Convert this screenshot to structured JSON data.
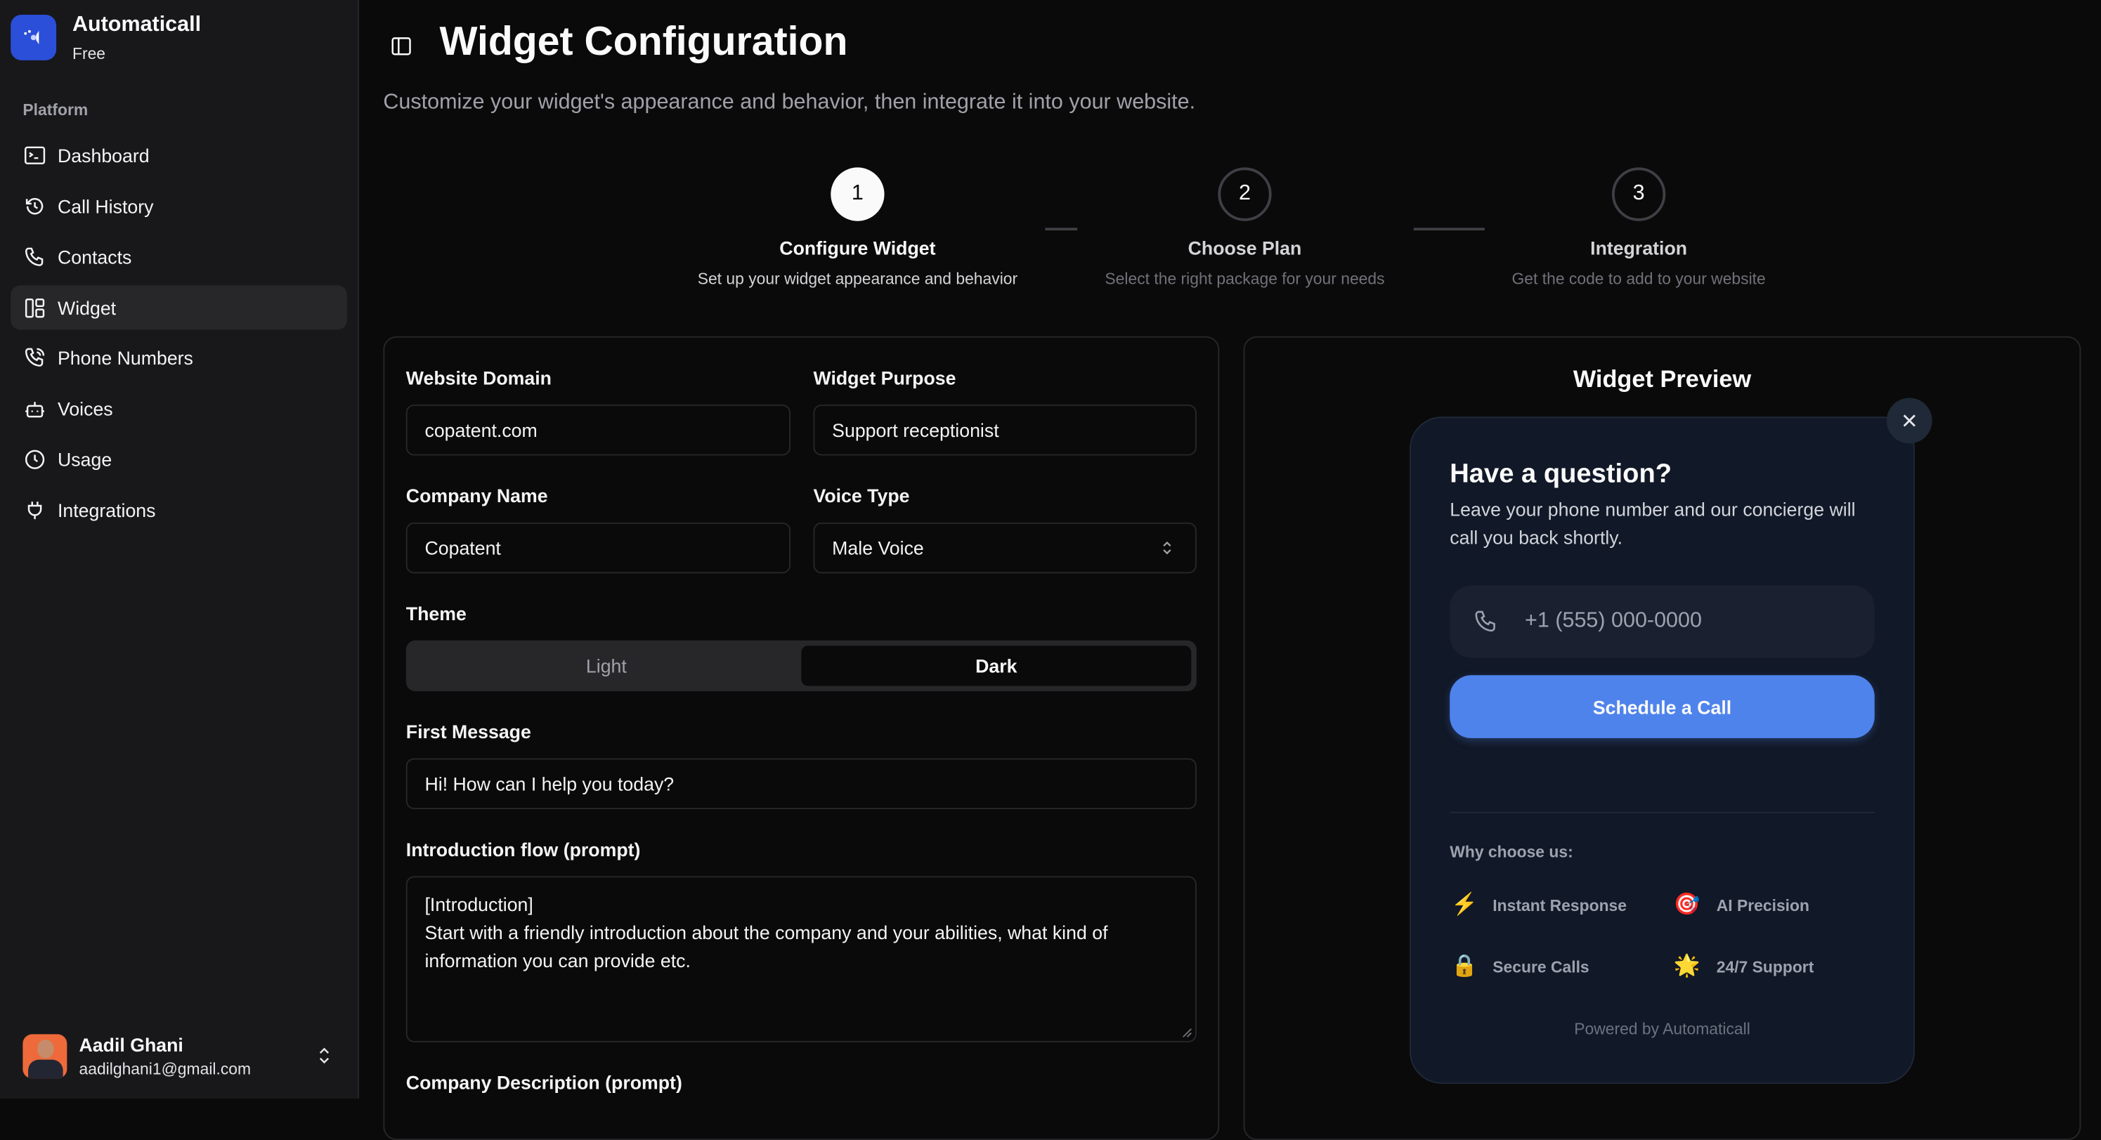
{
  "app": {
    "name": "Automaticall",
    "plan": "Free"
  },
  "sidebar": {
    "section_label": "Platform",
    "items": [
      {
        "label": "Dashboard",
        "icon": "terminal-icon"
      },
      {
        "label": "Call History",
        "icon": "history-icon"
      },
      {
        "label": "Contacts",
        "icon": "phone-icon"
      },
      {
        "label": "Widget",
        "icon": "layout-icon",
        "active": true
      },
      {
        "label": "Phone Numbers",
        "icon": "phone-call-icon"
      },
      {
        "label": "Voices",
        "icon": "bot-icon"
      },
      {
        "label": "Usage",
        "icon": "clock-icon"
      },
      {
        "label": "Integrations",
        "icon": "plug-icon"
      }
    ],
    "user": {
      "name": "Aadil Ghani",
      "email": "aadilghani1@gmail.com"
    }
  },
  "header": {
    "title": "Widget Configuration",
    "subtitle": "Customize your widget's appearance and behavior, then integrate it into your website."
  },
  "stepper": [
    {
      "number": "1",
      "title": "Configure Widget",
      "description": "Set up your widget appearance and behavior",
      "active": true
    },
    {
      "number": "2",
      "title": "Choose Plan",
      "description": "Select the right package for your needs"
    },
    {
      "number": "3",
      "title": "Integration",
      "description": "Get the code to add to your website"
    }
  ],
  "form": {
    "website_domain": {
      "label": "Website Domain",
      "value": "copatent.com"
    },
    "widget_purpose": {
      "label": "Widget Purpose",
      "value": "Support receptionist"
    },
    "company_name": {
      "label": "Company Name",
      "value": "Copatent"
    },
    "voice_type": {
      "label": "Voice Type",
      "value": "Male Voice"
    },
    "theme": {
      "label": "Theme",
      "options": [
        "Light",
        "Dark"
      ],
      "selected": "Dark"
    },
    "first_message": {
      "label": "First Message",
      "value": "Hi! How can I help you today?"
    },
    "intro_flow": {
      "label": "Introduction flow (prompt)",
      "line1": "[Introduction]",
      "line2": "Start with a friendly introduction about the company and your abilities, what kind of information you can provide etc."
    },
    "company_description": {
      "label": "Company Description (prompt)"
    }
  },
  "preview": {
    "title": "Widget Preview",
    "heading": "Have a question?",
    "description": "Leave your phone number and our concierge will call you back shortly.",
    "phone_placeholder": "+1 (555) 000-0000",
    "button": "Schedule a Call",
    "why_label": "Why choose us:",
    "features": [
      {
        "icon": "⚡",
        "label": "Instant Response"
      },
      {
        "icon": "🎯",
        "label": "AI Precision"
      },
      {
        "icon": "🔒",
        "label": "Secure Calls"
      },
      {
        "icon": "🌟",
        "label": "24/7 Support"
      }
    ],
    "powered_by": "Powered by Automaticall",
    "colors": {
      "accent": "#4f83ec",
      "card_bg": "#111827"
    }
  }
}
